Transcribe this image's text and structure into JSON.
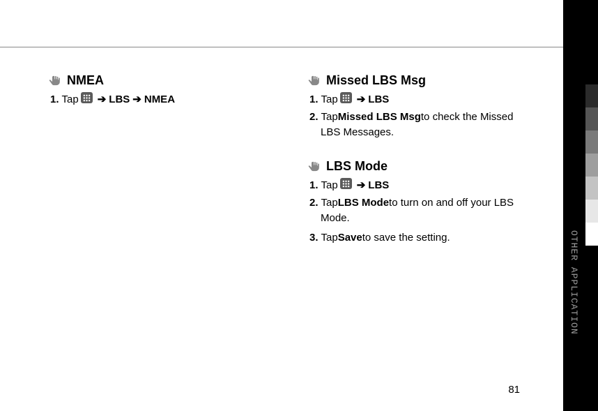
{
  "sideLabel": "OTHER APPLICATION",
  "pageNumber": "81",
  "left": {
    "nmea": {
      "title": "NMEA",
      "steps": {
        "s1": {
          "num": "1.",
          "pre": "Tap",
          "lbs": "LBS",
          "nmea": "NMEA"
        }
      }
    }
  },
  "right": {
    "missed": {
      "title": "Missed LBS Msg",
      "steps": {
        "s1": {
          "num": "1.",
          "pre": "Tap",
          "lbs": "LBS"
        },
        "s2": {
          "num": "2.",
          "pre": "Tap ",
          "bold": "Missed LBS Msg",
          "post": " to check the Missed",
          "body": "LBS Messages."
        }
      }
    },
    "mode": {
      "title": "LBS Mode",
      "steps": {
        "s1": {
          "num": "1.",
          "pre": "Tap",
          "lbs": "LBS"
        },
        "s2": {
          "num": "2.",
          "pre": "Tap ",
          "bold": "LBS Mode",
          "post": " to turn on and off your LBS",
          "body": "Mode."
        },
        "s3": {
          "num": "3.",
          "pre": "Tap ",
          "bold": "Save",
          "post": " to save the setting."
        }
      }
    }
  },
  "tabs": {
    "colors": [
      "#000000",
      "#2b2b2b",
      "#555555",
      "#7a7a7a",
      "#9e9e9e",
      "#c3c3c3",
      "#e7e7e7",
      "#ffffff"
    ]
  }
}
